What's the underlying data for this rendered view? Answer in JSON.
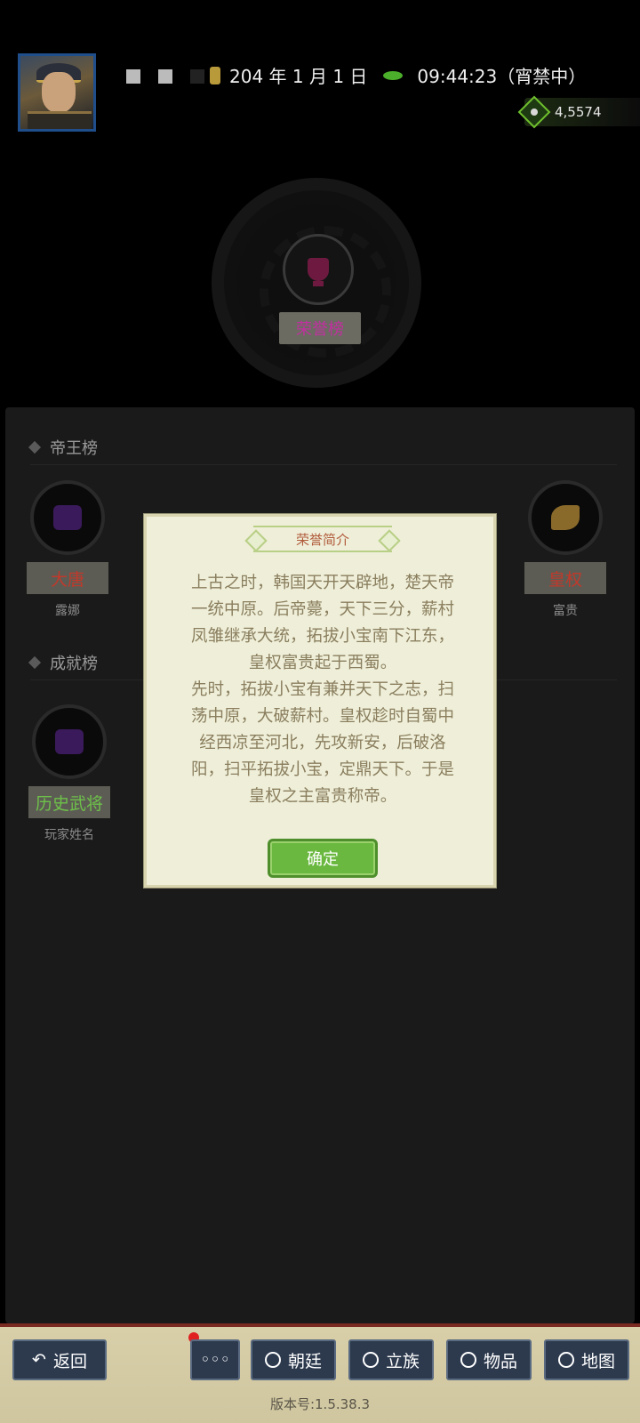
{
  "header": {
    "date": "204 年 1 月 1 日",
    "time": "09:44:23（宵禁中）",
    "currency": "4,5574"
  },
  "honor": {
    "label": "荣誉榜"
  },
  "sections": {
    "emperor": {
      "title": "帝王榜"
    },
    "achievement": {
      "title": "成就榜"
    }
  },
  "emperor_items": [
    {
      "tag": "大唐",
      "sub": "露娜",
      "tag_color": "#c0392b"
    },
    {
      "tag": "皇权",
      "sub": "富贵",
      "tag_color": "#c0392b"
    }
  ],
  "achievement_items": [
    {
      "tag": "历史武将",
      "sub": "玩家姓名",
      "tag_color": "#6ec04a"
    }
  ],
  "dialog": {
    "title": "荣誉简介",
    "lines": [
      "上古之时，韩国天开天辟地，楚天帝",
      "一统中原。后帝薨，天下三分，薪村",
      "凤雏继承大统，拓拔小宝南下江东，",
      "皇权富贵起于西蜀。",
      "先时，拓拔小宝有兼并天下之志，扫",
      "荡中原，大破薪村。皇权趁时自蜀中",
      "经西凉至河北，先攻新安，后破洛",
      "阳，扫平拓拔小宝，定鼎天下。于是",
      "皇权之主富贵称帝。"
    ],
    "confirm": "确定"
  },
  "nav": {
    "back": "返回",
    "more": "◦◦◦",
    "court": "朝廷",
    "clan": "立族",
    "items": "物品",
    "map": "地图"
  },
  "version": "版本号:1.5.38.3",
  "colors": {
    "accent_green": "#6ab83f",
    "honor_magenta": "#c22fa0",
    "nav_blue": "#2d3a4e"
  }
}
